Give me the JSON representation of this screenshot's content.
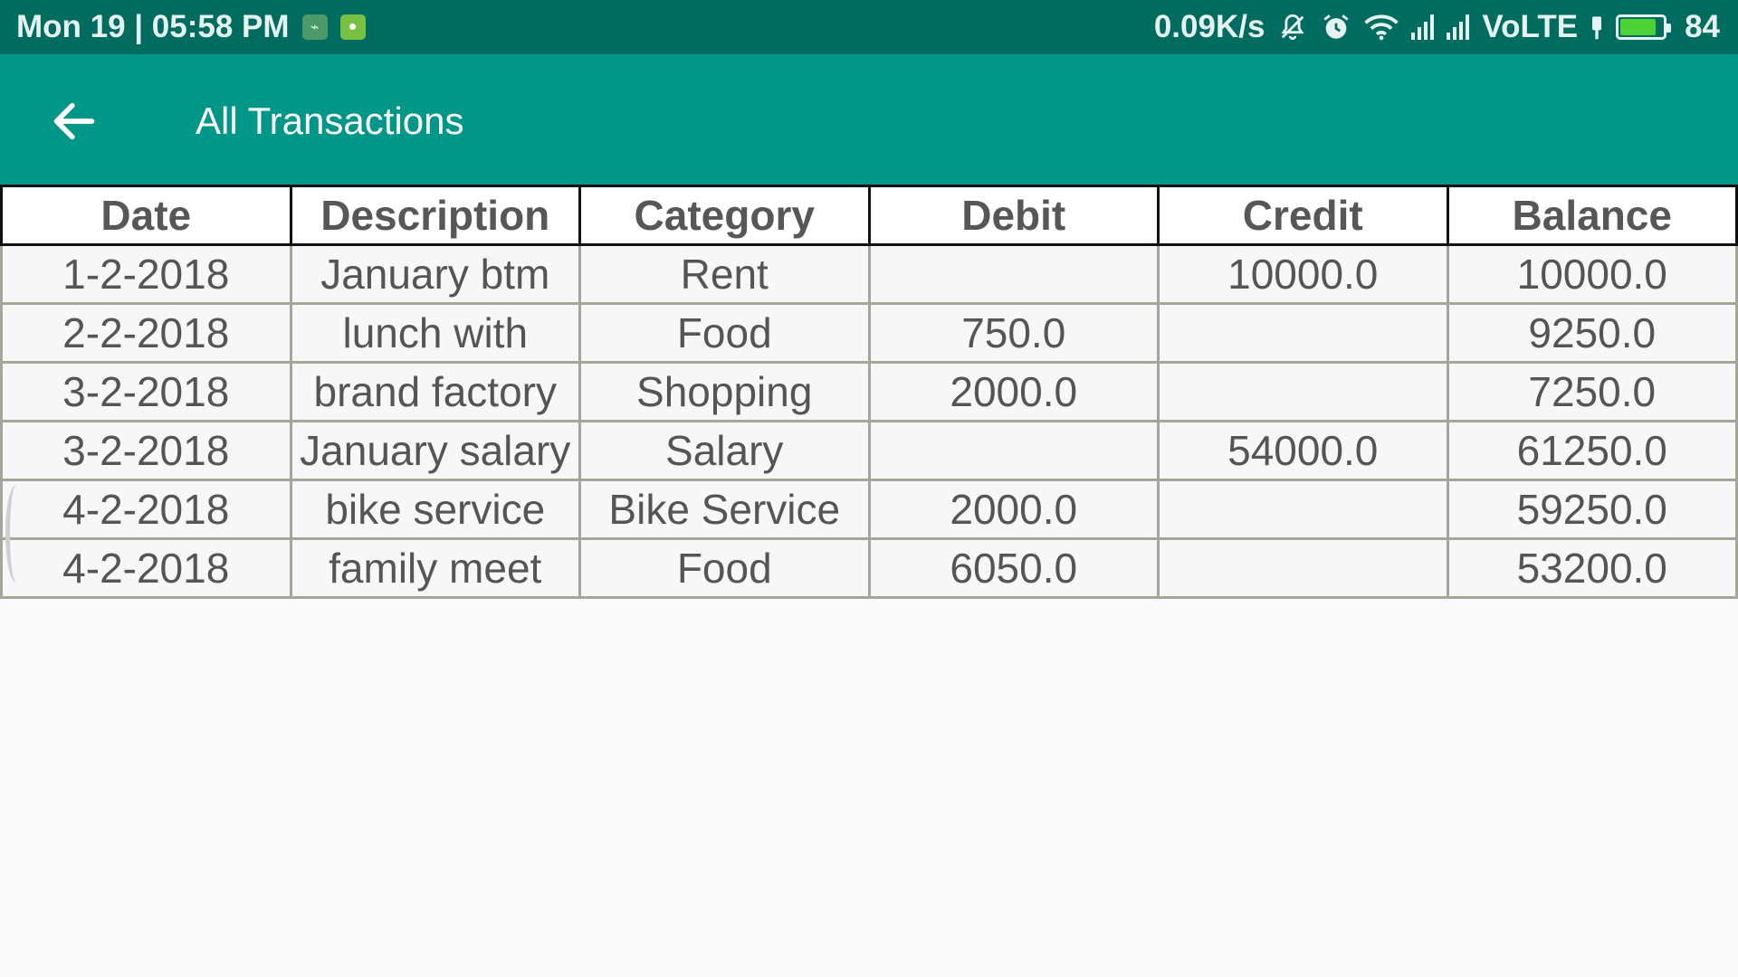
{
  "status_bar": {
    "datetime": "Mon 19 | 05:58 PM",
    "network_speed": "0.09K/s",
    "network_type": "VoLTE",
    "battery_level": "84",
    "battery_fraction": 0.84,
    "icons": [
      "usb-debug-icon",
      "android-icon",
      "mute-icon",
      "alarm-icon",
      "wifi-icon",
      "signal-icon",
      "signal-icon",
      "charging-icon",
      "battery-icon"
    ],
    "battery_color": "#4cd137"
  },
  "app_bar": {
    "title": "All Transactions",
    "back_icon": "arrow-left-icon",
    "color": "#009688"
  },
  "table": {
    "headers": [
      "Date",
      "Description",
      "Category",
      "Debit",
      "Credit",
      "Balance"
    ],
    "rows": [
      [
        "1-2-2018",
        "January btm",
        "Rent",
        "",
        "10000.0",
        "10000.0"
      ],
      [
        "2-2-2018",
        "lunch with",
        "Food",
        "750.0",
        "",
        "9250.0"
      ],
      [
        "3-2-2018",
        "brand factory",
        "Shopping",
        "2000.0",
        "",
        "7250.0"
      ],
      [
        "3-2-2018",
        "January salary",
        "Salary",
        "",
        "54000.0",
        "61250.0"
      ],
      [
        "4-2-2018",
        "bike service",
        "Bike Service",
        "2000.0",
        "",
        "59250.0"
      ],
      [
        "4-2-2018",
        "family meet",
        "Food",
        "6050.0",
        "",
        "53200.0"
      ]
    ]
  }
}
